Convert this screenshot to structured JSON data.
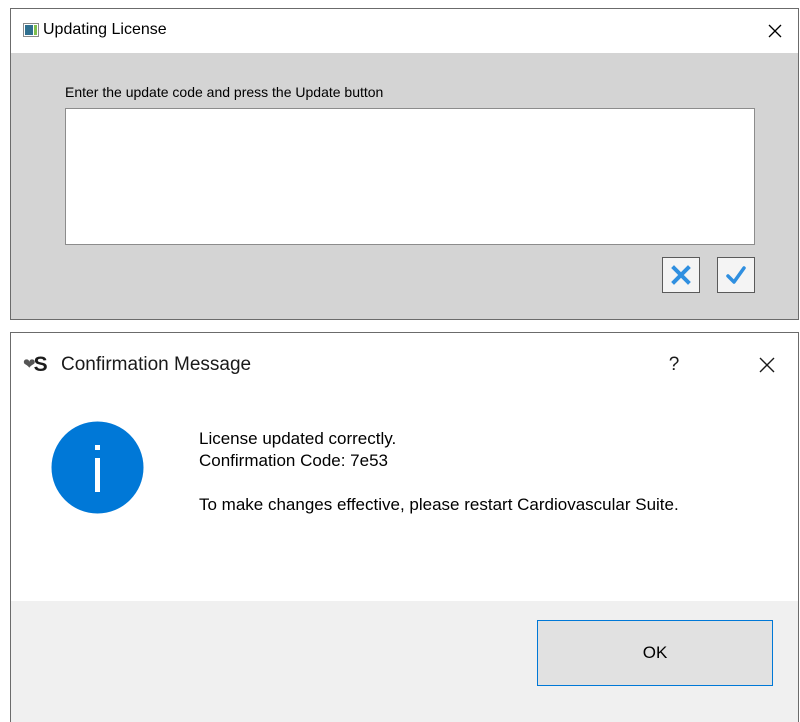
{
  "update_dialog": {
    "title": "Updating License",
    "prompt": "Enter the update code and press the Update button",
    "code_value": "",
    "icons": {
      "app": "app-icon",
      "close": "close-icon",
      "cancel": "x-icon",
      "update": "checkmark-icon"
    }
  },
  "confirm_dialog": {
    "title": "Confirmation Message",
    "help_label": "?",
    "message_line1": "License updated correctly.",
    "message_line2": "Confirmation Code: 7e53",
    "message_line3": "To make changes effective, please restart Cardiovascular Suite.",
    "ok_label": "OK",
    "icons": {
      "brand": "cs-logo-icon",
      "info": "info-icon",
      "close": "close-icon"
    }
  },
  "colors": {
    "info_blue": "#0078d7",
    "action_blue": "#2f8fe0",
    "dialog_gray": "#d4d4d4"
  }
}
